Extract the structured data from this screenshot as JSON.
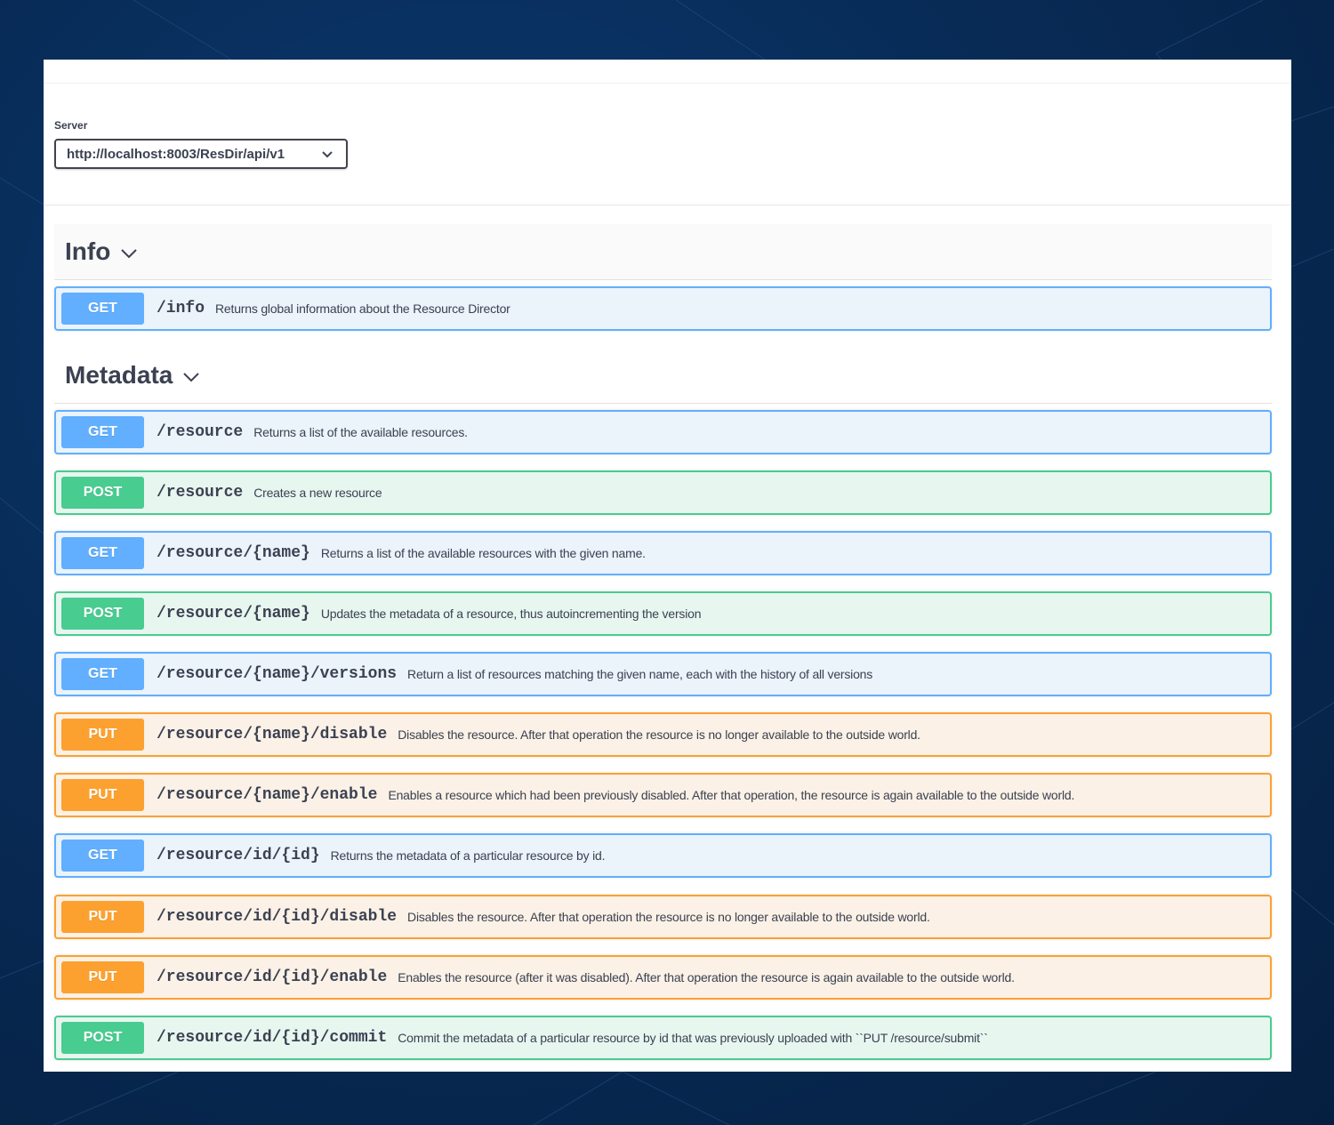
{
  "server": {
    "label": "Server",
    "selected": "http://localhost:8003/ResDir/api/v1"
  },
  "sections": [
    {
      "title": "Info",
      "operations": [
        {
          "method": "GET",
          "path": "/info",
          "description": "Returns global information about the Resource Director"
        }
      ]
    },
    {
      "title": "Metadata",
      "operations": [
        {
          "method": "GET",
          "path": "/resource",
          "description": "Returns a list of the available resources."
        },
        {
          "method": "POST",
          "path": "/resource",
          "description": "Creates a new resource"
        },
        {
          "method": "GET",
          "path": "/resource/{name}",
          "description": "Returns a list of the available resources with the given name."
        },
        {
          "method": "POST",
          "path": "/resource/{name}",
          "description": "Updates the metadata of a resource, thus autoincrementing the version"
        },
        {
          "method": "GET",
          "path": "/resource/{name}/versions",
          "description": "Return a list of resources matching the given name, each with the history of all versions"
        },
        {
          "method": "PUT",
          "path": "/resource/{name}/disable",
          "description": "Disables the resource. After that operation the resource is no longer available to the outside world."
        },
        {
          "method": "PUT",
          "path": "/resource/{name}/enable",
          "description": "Enables a resource which had been previously disabled. After that operation, the resource is again available to the outside world."
        },
        {
          "method": "GET",
          "path": "/resource/id/{id}",
          "description": "Returns the metadata of a particular resource by id."
        },
        {
          "method": "PUT",
          "path": "/resource/id/{id}/disable",
          "description": "Disables the resource. After that operation the resource is no longer available to the outside world."
        },
        {
          "method": "PUT",
          "path": "/resource/id/{id}/enable",
          "description": "Enables the resource (after it was disabled). After that operation the resource is again available to the outside world."
        },
        {
          "method": "POST",
          "path": "/resource/id/{id}/commit",
          "description": "Commit the metadata of a particular resource by id that was previously uploaded with ``PUT /resource/submit``"
        }
      ]
    }
  ],
  "colors": {
    "get": "#61affe",
    "post": "#49cc90",
    "put": "#fca130",
    "text": "#3b4151"
  }
}
